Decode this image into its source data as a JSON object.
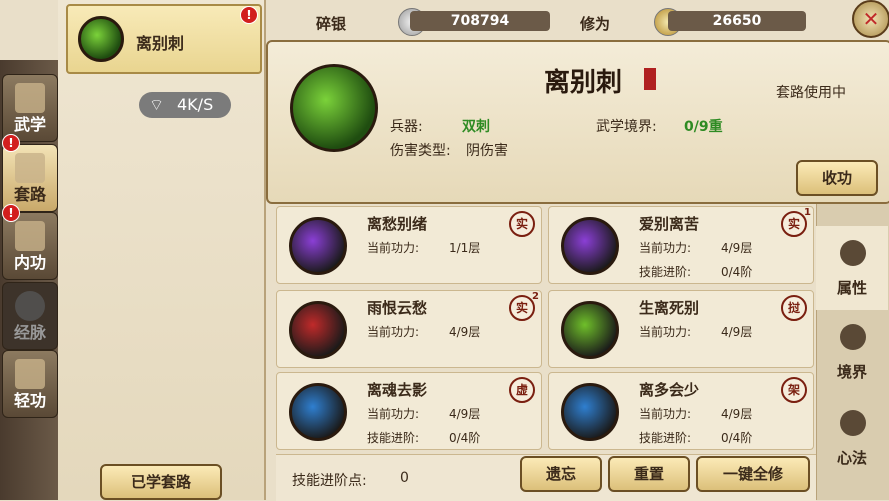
{
  "left_tabs": [
    {
      "label": "武学",
      "icon": "book-icon",
      "alert": false
    },
    {
      "label": "套路",
      "icon": "scroll-icon",
      "alert": true,
      "active": true
    },
    {
      "label": "内功",
      "icon": "meditation-icon",
      "alert": true
    },
    {
      "label": "经脉",
      "icon": "meridian-icon",
      "alert": false
    },
    {
      "label": "轻功",
      "icon": "boot-icon",
      "alert": false
    }
  ],
  "routine_list": {
    "selected_name": "离别刺",
    "alert": "!",
    "network_speed": "4K/S",
    "learned_button": "已学套路"
  },
  "currency": {
    "silver_label": "碎银",
    "silver_value": "708794",
    "cultivation_label": "修为",
    "cultivation_value": "26650"
  },
  "detail": {
    "title": "离别刺",
    "status": "套路使用中",
    "weapon_label": "兵器:",
    "weapon_value": "双刺",
    "realm_label": "武学境界:",
    "realm_value": "0/9重",
    "damage_label": "伤害类型:",
    "damage_value": "阴伤害",
    "action_button": "收功"
  },
  "skills": [
    {
      "name": "离愁别绪",
      "badge": "实",
      "badge_count": "",
      "power_label": "当前功力:",
      "power_value": "1/1层",
      "tech_label": "",
      "tech_value": "",
      "color": "#8b3fd6"
    },
    {
      "name": "爱别离苦",
      "badge": "实",
      "badge_count": "1",
      "power_label": "当前功力:",
      "power_value": "4/9层",
      "tech_label": "技能进阶:",
      "tech_value": "0/4阶",
      "color": "#8b3fd6"
    },
    {
      "name": "雨恨云愁",
      "badge": "实",
      "badge_count": "2",
      "power_label": "当前功力:",
      "power_value": "4/9层",
      "tech_label": "",
      "tech_value": "",
      "color": "#c02a2a"
    },
    {
      "name": "生离死别",
      "badge": "挝",
      "badge_count": "",
      "power_label": "当前功力:",
      "power_value": "4/9层",
      "tech_label": "",
      "tech_value": "",
      "color": "#6fbf2a"
    },
    {
      "name": "离魂去影",
      "badge": "虚",
      "badge_count": "",
      "power_label": "当前功力:",
      "power_value": "4/9层",
      "tech_label": "技能进阶:",
      "tech_value": "0/4阶",
      "color": "#2f7fd0"
    },
    {
      "name": "离多会少",
      "badge": "架",
      "badge_count": "",
      "power_label": "当前功力:",
      "power_value": "4/9层",
      "tech_label": "技能进阶:",
      "tech_value": "0/4阶",
      "color": "#2f7fd0"
    }
  ],
  "footer": {
    "points_label": "技能进阶点:",
    "points_value": "0",
    "forget_button": "遗忘",
    "reset_button": "重置",
    "repair_all_button": "一键全修"
  },
  "right_tabs": [
    {
      "label": "属性",
      "icon": "fighter-icon"
    },
    {
      "label": "境界",
      "icon": "stance-icon"
    },
    {
      "label": "心法",
      "icon": "monk-icon"
    }
  ],
  "close_icon": "close-icon"
}
